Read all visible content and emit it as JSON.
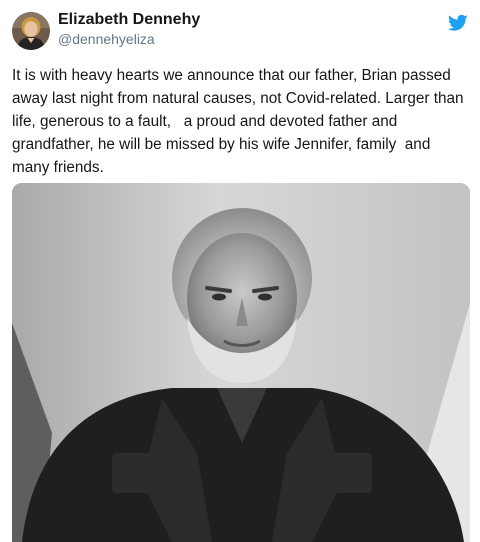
{
  "user": {
    "display_name": "Elizabeth Dennehy",
    "handle": "@dennehyeliza"
  },
  "icons": {
    "brand": "twitter-bird-icon",
    "brand_color": "#1da1f2"
  },
  "tweet": {
    "text": "It is with heavy hearts we announce that our father, Brian passed away last night from natural causes, not Covid-related. Larger than life, generous to a fault,   a proud and devoted father and grandfather, he will be missed by his wife Jennifer, family  and many friends."
  }
}
